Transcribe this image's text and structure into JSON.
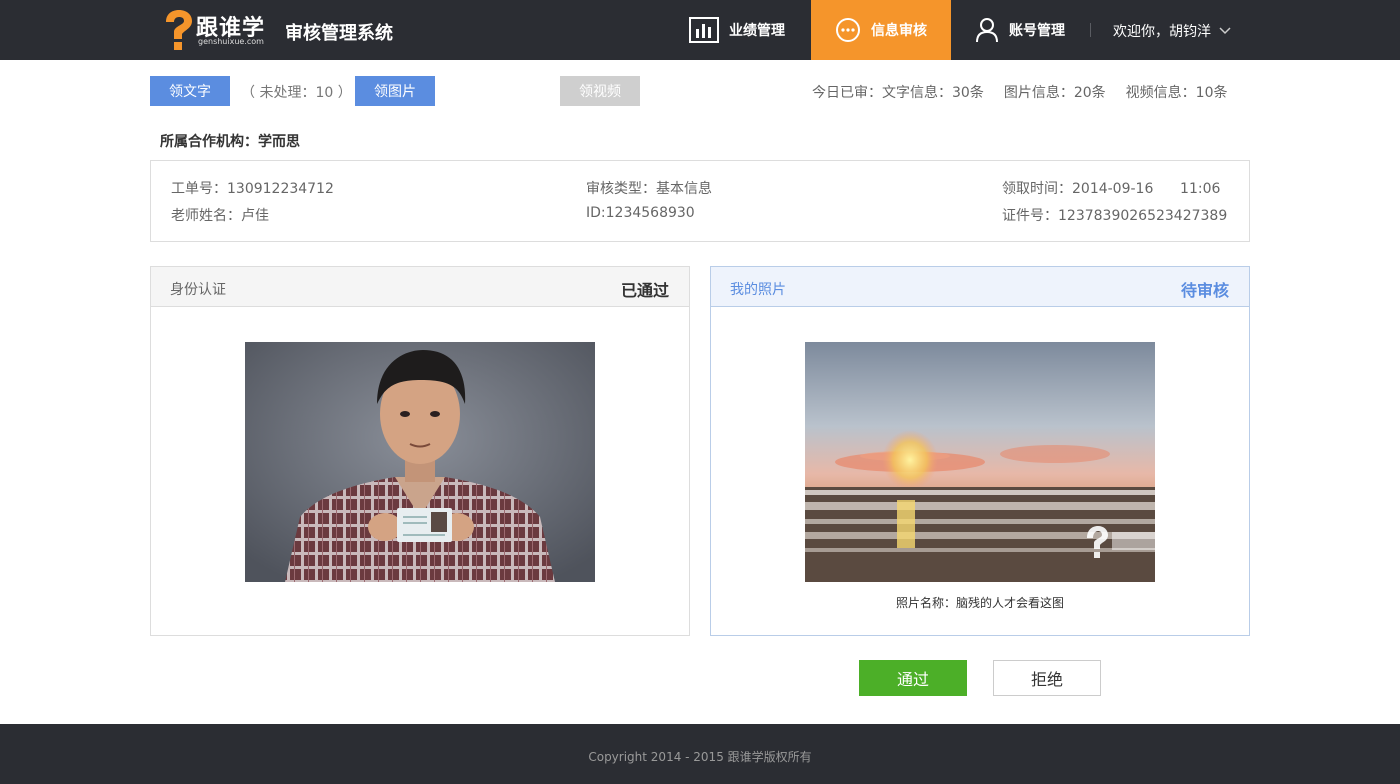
{
  "header": {
    "logo_text": "跟谁学",
    "logo_sub": "genshuixue.com",
    "system_title": "审核管理系统",
    "nav": {
      "performance": "业绩管理",
      "review": "信息审核",
      "account": "账号管理"
    },
    "welcome": "欢迎你，胡钧洋"
  },
  "toolbar": {
    "text_button": "领文字",
    "pending": "（ 未处理：10 ）",
    "image_button": "领图片",
    "video_button": "领视频",
    "stats": {
      "today": "今日已审：文字信息：30条",
      "images": "图片信息：20条",
      "videos": "视频信息：10条"
    }
  },
  "org": "所属合作机构：学而思",
  "info": {
    "ticket": "工单号：130912234712",
    "teacher": "老师姓名：卢佳",
    "review_type": "审核类型：基本信息",
    "id": "ID:1234568930",
    "receive_time": "领取时间：2014-09-16      11:06",
    "certificate": "证件号：1237839026523427389"
  },
  "panels": {
    "left": {
      "title": "身份认证",
      "status": "已通过"
    },
    "right": {
      "title": "我的照片",
      "status": "待审核",
      "caption_label": "照片名称：",
      "caption_value": "脑残的人才会看这图"
    }
  },
  "actions": {
    "pass": "通过",
    "reject": "拒绝"
  },
  "footer": {
    "copyright": "Copyright 2014 - 2015 跟谁学版权所有"
  },
  "colors": {
    "accent_orange": "#f5952b",
    "accent_blue": "#5b8de0",
    "pass_green": "#4caf28",
    "dark_bar": "#2b2d33"
  }
}
